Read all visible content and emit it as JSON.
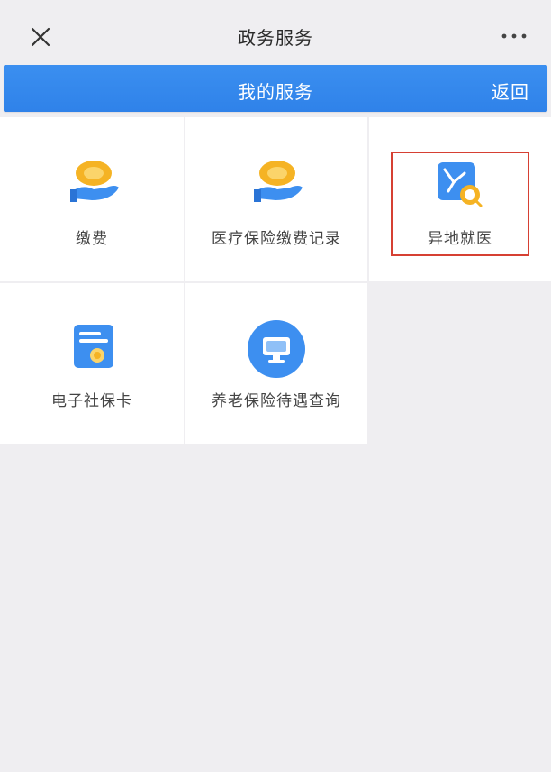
{
  "window": {
    "title": "政务服务",
    "close_icon": "close-icon",
    "more_icon": "more-icon"
  },
  "header": {
    "title": "我的服务",
    "action_label": "返回"
  },
  "services": [
    {
      "label": "缴费",
      "icon": "hand-coin-icon"
    },
    {
      "label": "医疗保险缴费记录",
      "icon": "hand-coin-icon"
    },
    {
      "label": "异地就医",
      "icon": "medical-search-icon"
    },
    {
      "label": "电子社保卡",
      "icon": "card-icon"
    },
    {
      "label": "养老保险待遇查询",
      "icon": "monitor-circle-icon"
    }
  ],
  "colors": {
    "accent": "#2f82e9",
    "highlight_border": "#d64033",
    "background": "#efeef1",
    "tile": "#ffffff"
  }
}
